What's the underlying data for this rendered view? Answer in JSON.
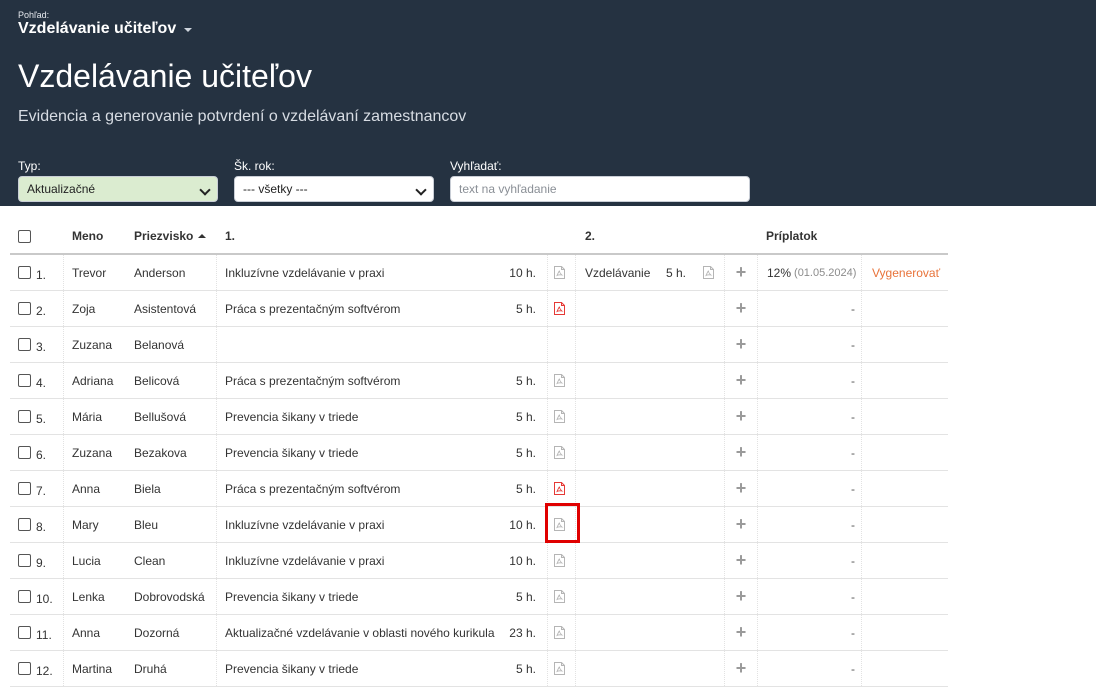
{
  "header": {
    "view_label": "Pohľad:",
    "view_name": "Vzdelávanie učiteľov",
    "title": "Vzdelávanie učiteľov",
    "subtitle": "Evidencia a generovanie potvrdení o vzdelávaní zamestnancov"
  },
  "filters": {
    "type_label": "Typ:",
    "type_value": "Aktualizačné",
    "year_label": "Šk. rok:",
    "year_value": "--- všetky ---",
    "search_label": "Vyhľadať:",
    "search_placeholder": "text na vyhľadanie"
  },
  "columns": {
    "name": "Meno",
    "surname": "Priezvisko",
    "first": "1.",
    "second": "2.",
    "bonus": "Príplatok"
  },
  "rows": [
    {
      "num": "1.",
      "name": "Trevor",
      "surname": "Anderson",
      "course1": "Inkluzívne vzdelávanie v praxi",
      "hours1": "10 h.",
      "pdf1": "grey",
      "course2": "Vzdelávanie",
      "hours2": "5 h.",
      "pdf2": "grey",
      "bonus": "12%",
      "bonus_date": "(01.05.2024)",
      "action": "Vygenerovať"
    },
    {
      "num": "2.",
      "name": "Zoja",
      "surname": "Asistentová",
      "course1": "Práca s prezentačným softvérom",
      "hours1": "5 h.",
      "pdf1": "red",
      "bonus": "-"
    },
    {
      "num": "3.",
      "name": "Zuzana",
      "surname": "Belanová",
      "course1": "",
      "hours1": "",
      "pdf1": "",
      "bonus": "-"
    },
    {
      "num": "4.",
      "name": "Adriana",
      "surname": "Belicová",
      "course1": "Práca s prezentačným softvérom",
      "hours1": "5 h.",
      "pdf1": "grey",
      "bonus": "-"
    },
    {
      "num": "5.",
      "name": "Mária",
      "surname": "Bellušová",
      "course1": "Prevencia šikany v triede",
      "hours1": "5 h.",
      "pdf1": "grey",
      "bonus": "-"
    },
    {
      "num": "6.",
      "name": "Zuzana",
      "surname": "Bezakova",
      "course1": "Prevencia šikany v triede",
      "hours1": "5 h.",
      "pdf1": "grey",
      "bonus": "-"
    },
    {
      "num": "7.",
      "name": "Anna",
      "surname": "Biela",
      "course1": "Práca s prezentačným softvérom",
      "hours1": "5 h.",
      "pdf1": "red",
      "bonus": "-"
    },
    {
      "num": "8.",
      "name": "Mary",
      "surname": "Bleu",
      "course1": "Inkluzívne vzdelávanie v praxi",
      "hours1": "10 h.",
      "pdf1": "grey",
      "bonus": "-"
    },
    {
      "num": "9.",
      "name": "Lucia",
      "surname": "Clean",
      "course1": "Inkluzívne vzdelávanie v praxi",
      "hours1": "10 h.",
      "pdf1": "grey",
      "bonus": "-"
    },
    {
      "num": "10.",
      "name": "Lenka",
      "surname": "Dobrovodská",
      "course1": "Prevencia šikany v triede",
      "hours1": "5 h.",
      "pdf1": "grey",
      "bonus": "-"
    },
    {
      "num": "11.",
      "name": "Anna",
      "surname": "Dozorná",
      "course1": "Aktualizačné vzdelávanie v oblasti nového kurikula",
      "hours1": "23 h.",
      "pdf1": "grey",
      "bonus": "-"
    },
    {
      "num": "12.",
      "name": "Martina",
      "surname": "Druhá",
      "course1": "Prevencia šikany v triede",
      "hours1": "5 h.",
      "pdf1": "grey",
      "bonus": "-"
    }
  ],
  "colors": {
    "header_bg": "#253241",
    "accent_orange": "#e8733a",
    "pdf_red": "#e53935",
    "pdf_grey": "#b5b5b5",
    "highlight": "#e00000"
  }
}
